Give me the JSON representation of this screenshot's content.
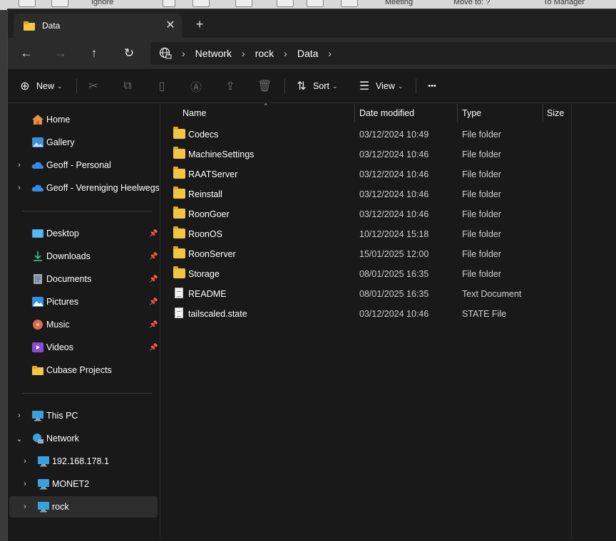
{
  "background_app": {
    "items": [
      "Ignore",
      "Meeting",
      "Move to: ?",
      "To Manager"
    ]
  },
  "tab": {
    "title": "Data",
    "close_glyph": "✕",
    "new_tab_glyph": "+"
  },
  "breadcrumb": {
    "items": [
      "Network",
      "rock",
      "Data"
    ]
  },
  "commandbar": {
    "new_label": "New",
    "sort_label": "Sort",
    "view_label": "View",
    "more_glyph": "•••"
  },
  "sidebar": {
    "items": [
      {
        "label": "Home",
        "icon": "home-icon"
      },
      {
        "label": "Gallery",
        "icon": "gallery-icon"
      },
      {
        "label": "Geoff - Personal",
        "icon": "cloud-icon"
      },
      {
        "label": "Geoff - Vereniging Heelwegs E",
        "icon": "cloud-icon"
      },
      {
        "label": "Desktop",
        "icon": "desktop-icon"
      },
      {
        "label": "Downloads",
        "icon": "download-icon"
      },
      {
        "label": "Documents",
        "icon": "documents-icon"
      },
      {
        "label": "Pictures",
        "icon": "pictures-icon"
      },
      {
        "label": "Music",
        "icon": "music-icon"
      },
      {
        "label": "Videos",
        "icon": "videos-icon"
      },
      {
        "label": "Cubase Projects",
        "icon": "folder-icon"
      },
      {
        "label": "This PC",
        "icon": "computer-icon"
      },
      {
        "label": "Network",
        "icon": "network-icon"
      },
      {
        "label": "192.168.178.1",
        "icon": "computer-icon"
      },
      {
        "label": "MONET2",
        "icon": "computer-icon"
      },
      {
        "label": "rock",
        "icon": "computer-icon"
      }
    ]
  },
  "columns": {
    "name": "Name",
    "date": "Date modified",
    "type": "Type",
    "size": "Size"
  },
  "files": [
    {
      "name": "Codecs",
      "date": "03/12/2024 10:49",
      "type": "File folder",
      "kind": "folder"
    },
    {
      "name": "MachineSettings",
      "date": "03/12/2024 10:46",
      "type": "File folder",
      "kind": "folder"
    },
    {
      "name": "RAATServer",
      "date": "03/12/2024 10:46",
      "type": "File folder",
      "kind": "folder"
    },
    {
      "name": "Reinstall",
      "date": "03/12/2024 10:46",
      "type": "File folder",
      "kind": "folder"
    },
    {
      "name": "RoonGoer",
      "date": "03/12/2024 10:46",
      "type": "File folder",
      "kind": "folder"
    },
    {
      "name": "RoonOS",
      "date": "10/12/2024 15:18",
      "type": "File folder",
      "kind": "folder"
    },
    {
      "name": "RoonServer",
      "date": "15/01/2025 12:00",
      "type": "File folder",
      "kind": "folder"
    },
    {
      "name": "Storage",
      "date": "08/01/2025 16:35",
      "type": "File folder",
      "kind": "folder"
    },
    {
      "name": "README",
      "date": "08/01/2025 16:35",
      "type": "Text Document",
      "kind": "file"
    },
    {
      "name": "tailscaled.state",
      "date": "03/12/2024 10:46",
      "type": "STATE File",
      "kind": "file"
    }
  ]
}
